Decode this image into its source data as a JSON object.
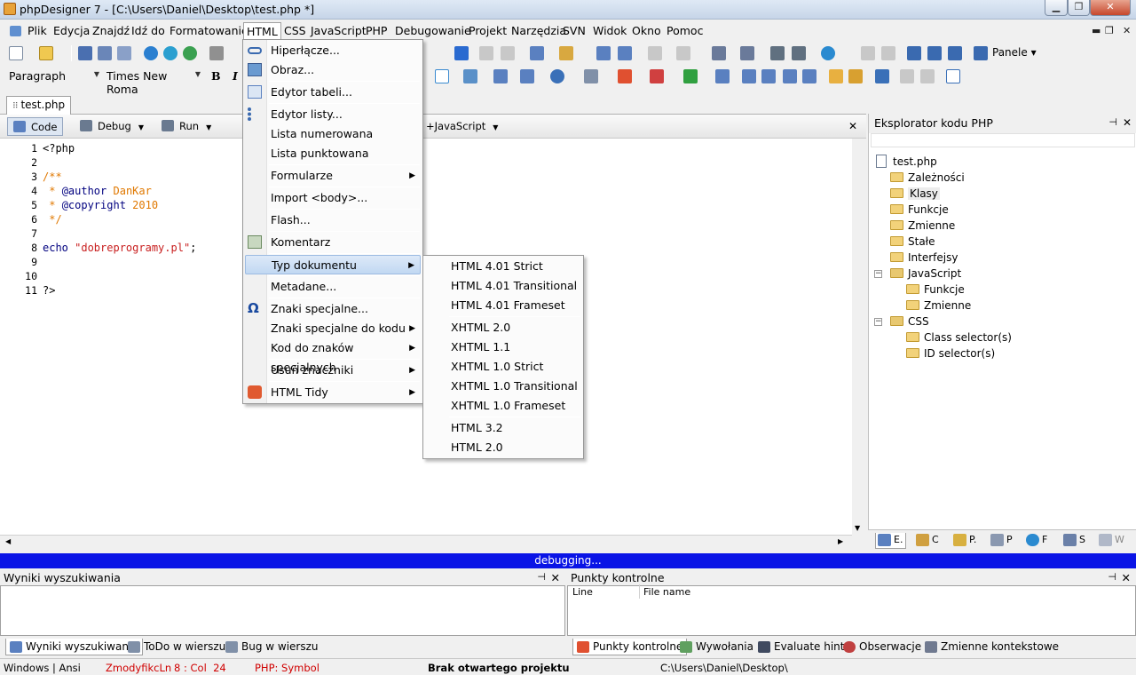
{
  "window": {
    "title": "phpDesigner 7 - [C:\\Users\\Daniel\\Desktop\\test.php *]"
  },
  "menubar": {
    "items": [
      "Plik",
      "Edycja",
      "Znajdź",
      "Idź do",
      "Formatowanie",
      "HTML",
      "CSS",
      "JavaScript",
      "PHP",
      "Debugowanie",
      "Projekt",
      "Narzędzia",
      "SVN",
      "Widok",
      "Okno",
      "Pomoc"
    ],
    "active": "HTML"
  },
  "toolbar2": {
    "paragraph": "Paragraph",
    "font": "Times New Roma",
    "bold": "B",
    "italic": "I",
    "panels_label": "Panele"
  },
  "filetab": {
    "label": "test.php"
  },
  "editor_toolbar": {
    "code": "Code",
    "debug": "Debug",
    "run": "Run",
    "syntax": "+JavaScript",
    "close": "✕"
  },
  "editor": {
    "lines": [
      {
        "n": "1",
        "text": "<?php"
      },
      {
        "n": "2",
        "text": ""
      },
      {
        "n": "3",
        "text": "/**"
      },
      {
        "n": "4",
        "text": " * @author DanKar"
      },
      {
        "n": "5",
        "text": " * @copyright 2010"
      },
      {
        "n": "6",
        "text": " */"
      },
      {
        "n": "7",
        "text": ""
      },
      {
        "n": "8",
        "text": "echo \"dobreprogramy.pl\";"
      },
      {
        "n": "9",
        "text": ""
      },
      {
        "n": "10",
        "text": ""
      },
      {
        "n": "11",
        "text": "?>"
      }
    ],
    "l4_a": " * ",
    "l4_b": "@author",
    "l4_c": " DanKar",
    "l5_a": " * ",
    "l5_b": "@copyright",
    "l5_c": " 2010",
    "l8_a": "echo ",
    "l8_b": "\"dobreprogramy.pl\"",
    "l8_c": ";"
  },
  "html_menu": {
    "items": [
      "Hiperłącze...",
      "Obraz...",
      "Edytor tabeli...",
      "Edytor listy...",
      "Lista numerowana",
      "Lista punktowana",
      "Formularze",
      "Import <body>...",
      "Flash...",
      "Komentarz",
      "Typ dokumentu",
      "Metadane...",
      "Znaki specjalne...",
      "Znaki specjalne do kodu",
      "Kod do znaków specjalnych",
      "Usuń znaczniki",
      "HTML Tidy"
    ]
  },
  "doctype_menu": {
    "items": [
      "HTML 4.01 Strict",
      "HTML 4.01 Transitional",
      "HTML 4.01 Frameset",
      "XHTML 2.0",
      "XHTML 1.1",
      "XHTML 1.0 Strict",
      "XHTML 1.0 Transitional",
      "XHTML 1.0 Frameset",
      "HTML 3.2",
      "HTML 2.0"
    ]
  },
  "right_panel": {
    "title": "Eksplorator kodu PHP",
    "tree": [
      "test.php",
      "Zależności",
      "Klasy",
      "Funkcje",
      "Zmienne",
      "Stałe",
      "Interfejsy",
      "JavaScript",
      "Funkcje",
      "Zmienne",
      "CSS",
      "Class selector(s)",
      "ID selector(s)"
    ],
    "tabs": [
      "E.",
      "C",
      "P.",
      "P",
      "F",
      "S",
      "W"
    ]
  },
  "debug_status": "debugging...",
  "search_panel": {
    "title": "Wyniki wyszukiwania"
  },
  "breakpoints_panel": {
    "title": "Punkty kontrolne",
    "col_line": "Line",
    "col_file": "File name"
  },
  "bottom_tabs_left": [
    "Wyniki wyszukiwania",
    "ToDo w wierszu",
    "Bug w wierszu"
  ],
  "bottom_tabs_right": [
    "Punkty kontrolne",
    "Wywołania",
    "Evaluate hint",
    "Obserwacje",
    "Zmienne kontekstowe"
  ],
  "statusbar": {
    "encoding": "Windows | Ansi",
    "modified": "ZmodyfikcLn",
    "pos": "8 : Col  24",
    "syntax": "PHP: Symbol",
    "project": "Brak otwartego projektu",
    "path": "C:\\Users\\Daniel\\Desktop\\"
  },
  "colors": {
    "keyword": "#00007f",
    "comment": "#e07800",
    "string": "#c81e1e",
    "debug_bar": "#0a14e6"
  }
}
